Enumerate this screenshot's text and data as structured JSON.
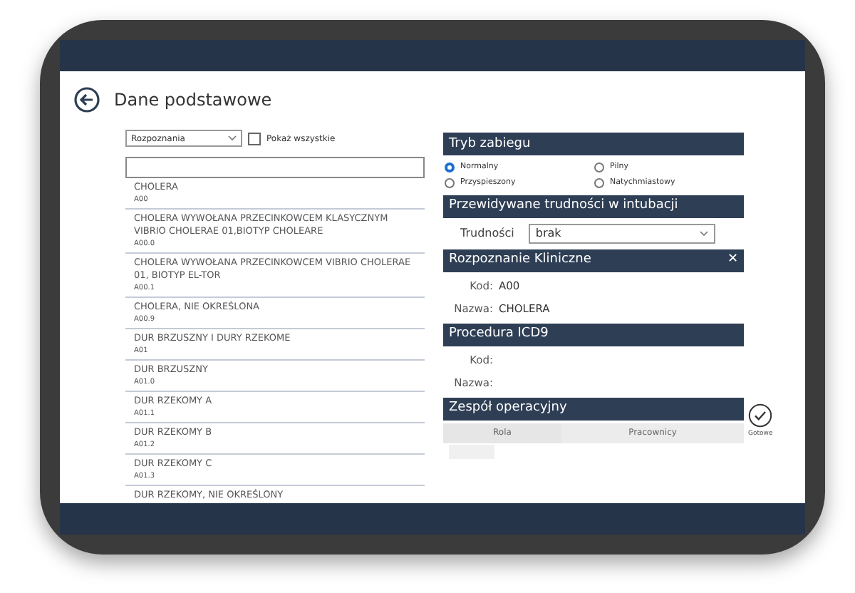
{
  "page": {
    "title": "Dane podstawowe"
  },
  "filter": {
    "dropdown": "Rozpoznania",
    "show_all": {
      "label": "Pokaż wszystkie",
      "checked": false
    }
  },
  "diagnoses": [
    {
      "name": "CHOLERA",
      "code": "A00"
    },
    {
      "name": "CHOLERA WYWOŁANA PRZECINKOWCEM KLASYCZNYM VIBRIO CHOLERAE 01,BIOTYP CHOLEARE",
      "code": "A00.0"
    },
    {
      "name": "CHOLERA WYWOŁANA PRZECINKOWCEM  VIBRIO CHOLERAE 01, BIOTYP EL-TOR",
      "code": "A00.1"
    },
    {
      "name": "CHOLERA, NIE OKREŚLONA",
      "code": "A00.9"
    },
    {
      "name": "DUR BRZUSZNY I DURY RZEKOME",
      "code": "A01"
    },
    {
      "name": "DUR BRZUSZNY",
      "code": "A01.0"
    },
    {
      "name": "DUR RZEKOMY A",
      "code": "A01.1"
    },
    {
      "name": "DUR RZEKOMY B",
      "code": "A01.2"
    },
    {
      "name": "DUR RZEKOMY C",
      "code": "A01.3"
    },
    {
      "name": "DUR RZEKOMY, NIE OKREŚLONY"
    }
  ],
  "procedure_mode": {
    "title": "Tryb zabiegu",
    "options": [
      {
        "label": "Normalny",
        "selected": true
      },
      {
        "label": "Pilny",
        "selected": false
      },
      {
        "label": "Przyspieszony",
        "selected": false
      },
      {
        "label": "Natychmiastowy",
        "selected": false
      }
    ]
  },
  "intubation": {
    "title": "Przewidywane trudności w intubacji",
    "label": "Trudności",
    "value": "brak"
  },
  "clinical_diagnosis": {
    "title": "Rozpoznanie Kliniczne",
    "close": "✕",
    "fields": [
      {
        "label": "Kod:",
        "value": "A00"
      },
      {
        "label": "Nazwa:",
        "value": "CHOLERA"
      }
    ]
  },
  "icd9": {
    "title": "Procedura ICD9",
    "fields": [
      {
        "label": "Kod:"
      },
      {
        "label": "Nazwa:"
      }
    ]
  },
  "team": {
    "title": "Zespół operacyjny",
    "columns": [
      "Rola",
      "Pracownicy"
    ]
  },
  "done_button": {
    "label": "Gotowe"
  }
}
